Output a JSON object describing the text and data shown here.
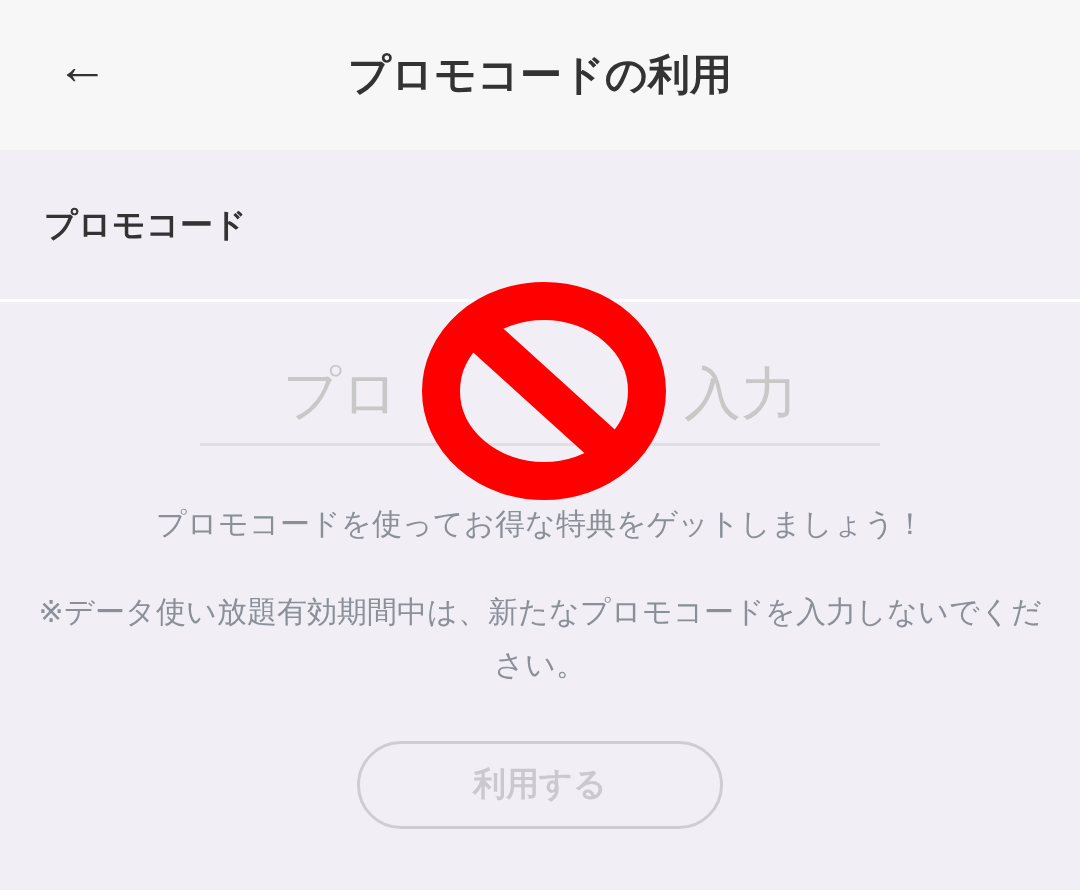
{
  "header": {
    "back": "←",
    "title": "プロモコードの利用"
  },
  "section": {
    "label": "プロモコード"
  },
  "promo_field": {
    "placeholder_parts": [
      "プロ",
      "入力"
    ]
  },
  "overlay": {
    "kind": "prohibited"
  },
  "description": "プロモコードを使ってお得な特典をゲットしましょう！",
  "note": "※データ使い放題有効期間中は、新たなプロモコードを入力しないでください。",
  "apply_button": {
    "label": "利用する",
    "disabled": true
  }
}
